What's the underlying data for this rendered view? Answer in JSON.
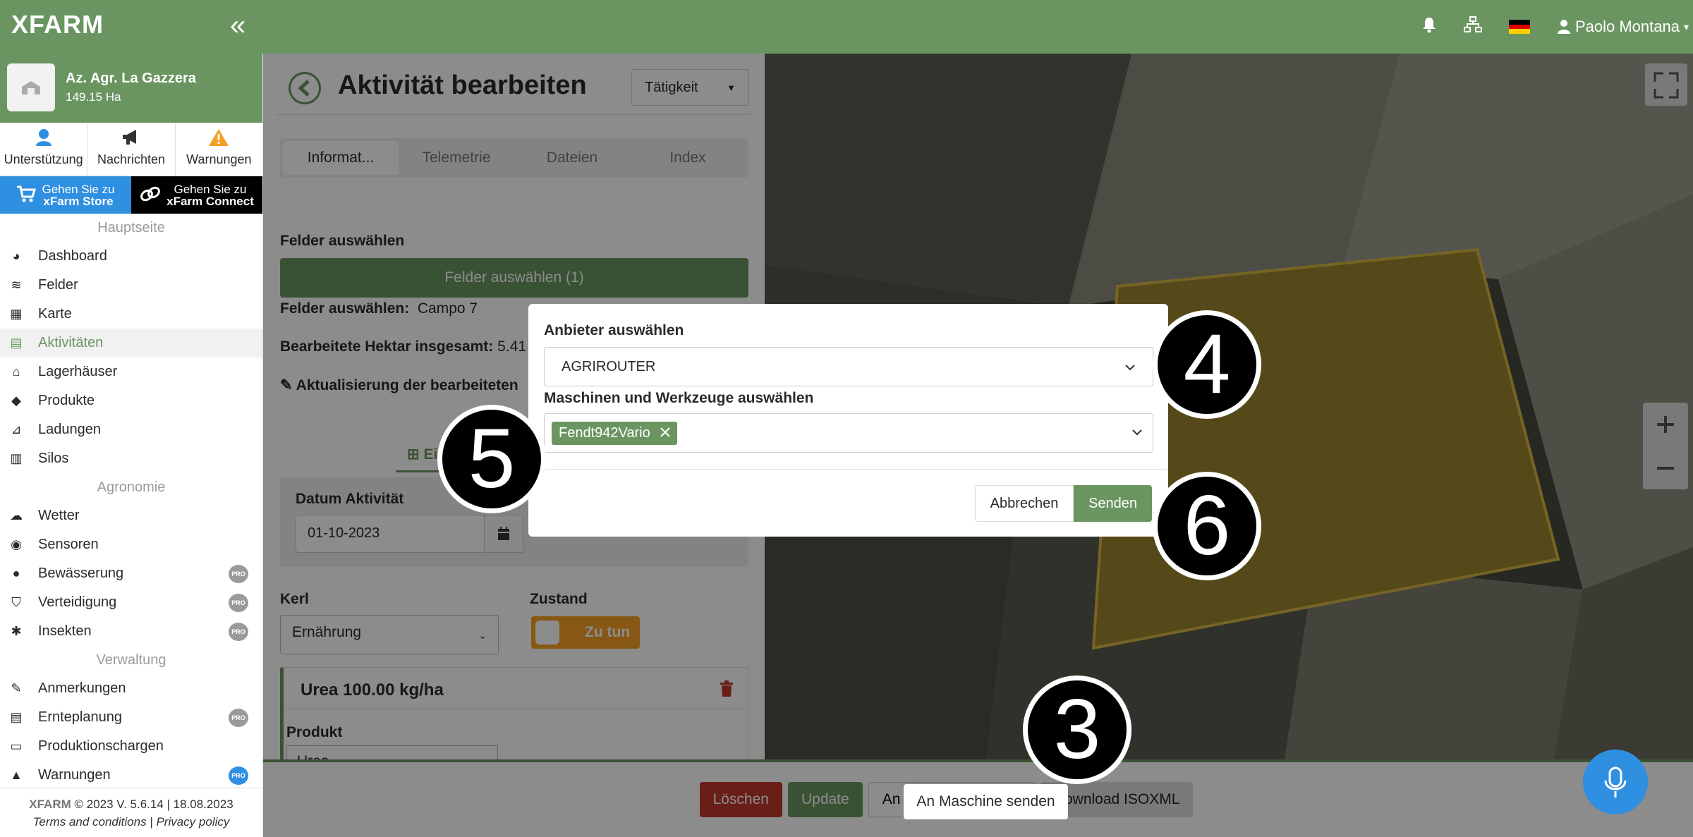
{
  "app": {
    "logo": "XFARM",
    "collapse_icon": "«"
  },
  "topbar": {
    "bell_icon": "bell-icon",
    "network_icon": "sitemap-icon",
    "user": "Paolo Montana",
    "flag_colors": [
      "#000000",
      "#dd0000",
      "#ffce00"
    ]
  },
  "farm": {
    "name": "Az. Agr. La Gazzera",
    "area": "149.15 Ha"
  },
  "quick_links": [
    {
      "label": "Unterstützung",
      "icon": "support-icon"
    },
    {
      "label": "Nachrichten",
      "icon": "megaphone-icon"
    },
    {
      "label": "Warnungen",
      "icon": "warning-icon"
    }
  ],
  "store_links": [
    {
      "line1": "Gehen Sie zu",
      "line2": "xFarm Store"
    },
    {
      "line1": "Gehen Sie zu",
      "line2": "xFarm Connect"
    }
  ],
  "nav": {
    "section_main": "Hauptseite",
    "main_items": [
      {
        "label": "Dashboard"
      },
      {
        "label": "Felder"
      },
      {
        "label": "Karte"
      },
      {
        "label": "Aktivitäten"
      },
      {
        "label": "Lagerhäuser"
      },
      {
        "label": "Produkte"
      },
      {
        "label": "Ladungen"
      },
      {
        "label": "Silos"
      }
    ],
    "section_agro": "Agronomie",
    "agro_items": [
      {
        "label": "Wetter"
      },
      {
        "label": "Sensoren"
      },
      {
        "label": "Bewässerung"
      },
      {
        "label": "Verteidigung"
      },
      {
        "label": "Insekten"
      }
    ],
    "section_admin": "Verwaltung",
    "admin_items": [
      {
        "label": "Anmerkungen"
      },
      {
        "label": "Ernteplanung"
      },
      {
        "label": "Produktionschargen"
      },
      {
        "label": "Warnungen"
      }
    ],
    "pro_label": "PRO"
  },
  "footer": {
    "logo": "XFARM",
    "version": "© 2023 V. 5.6.14 | 18.08.2023",
    "terms": "Terms and conditions",
    "privacy": "Privacy policy"
  },
  "panel": {
    "title": "Aktivität bearbeiten",
    "type_select": "Tätigkeit",
    "tabs": [
      "Informat...",
      "Telemetrie",
      "Dateien",
      "Index"
    ],
    "fields_heading": "Felder auswählen",
    "fields_button": "Felder auswählen (1)",
    "fields_selected_label": "Felder auswählen:",
    "fields_selected_value": "Campo 7",
    "hectares_label": "Bearbeitete Hektar insgesamt:",
    "hectares_value": "5.41",
    "update_link": "Aktualisierung der bearbeiteten",
    "subtab_label": "Ei",
    "date_label": "Datum Aktivität",
    "date_value": "01-10-2023",
    "kerl_label": "Kerl",
    "kerl_value": "Ernährung",
    "state_label": "Zustand",
    "state_value": "Zu tun",
    "product_header": "Urea 100.00 kg/ha",
    "product_label": "Produkt",
    "product_value": "Urea"
  },
  "modal": {
    "provider_label": "Anbieter auswählen",
    "provider_value": "AGRIROUTER",
    "machines_label": "Maschinen und Werkzeuge auswählen",
    "machine_tag": "Fendt942Vario",
    "cancel": "Abbrechen",
    "send": "Senden"
  },
  "badges": {
    "b3": "3",
    "b4": "4",
    "b5": "5",
    "b6": "6"
  },
  "bottom": {
    "delete": "Löschen",
    "update": "Update",
    "send_machine": "An Maschine senden",
    "download": "Download ISOXML"
  },
  "colors": {
    "brand": "#6a9560",
    "danger": "#c0392b",
    "store_blue": "#2f8fe0",
    "state_orange": "#f4a024"
  }
}
